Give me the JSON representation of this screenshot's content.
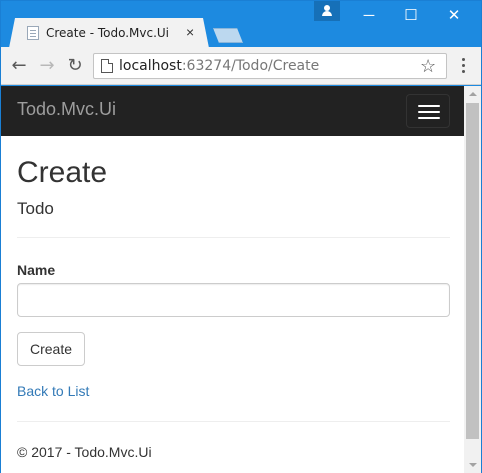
{
  "browser": {
    "tab": {
      "title": "Create - Todo.Mvc.Ui",
      "close_glyph": "×"
    },
    "window_controls": {
      "minimize": "─",
      "maximize": "☐",
      "close": "✕"
    },
    "nav": {
      "back": "←",
      "forward": "→",
      "reload": "↻"
    },
    "address": {
      "host": "localhost",
      "path": ":63274/Todo/Create"
    },
    "bookmark_star": "☆"
  },
  "app": {
    "brand": "Todo.Mvc.Ui",
    "page_title": "Create",
    "subtitle": "Todo",
    "form": {
      "name_label": "Name",
      "name_value": "",
      "submit_label": "Create"
    },
    "back_link": "Back to List",
    "footer": "© 2017 - Todo.Mvc.Ui"
  },
  "colors": {
    "titlebar": "#1d8ae0",
    "navbar": "#222222",
    "brand_text": "#9d9d9d",
    "link": "#337ab7"
  },
  "icons": {
    "favicon": "page-icon",
    "user": "user-icon",
    "menu": "kebab-menu-icon",
    "hamburger": "hamburger-icon"
  }
}
